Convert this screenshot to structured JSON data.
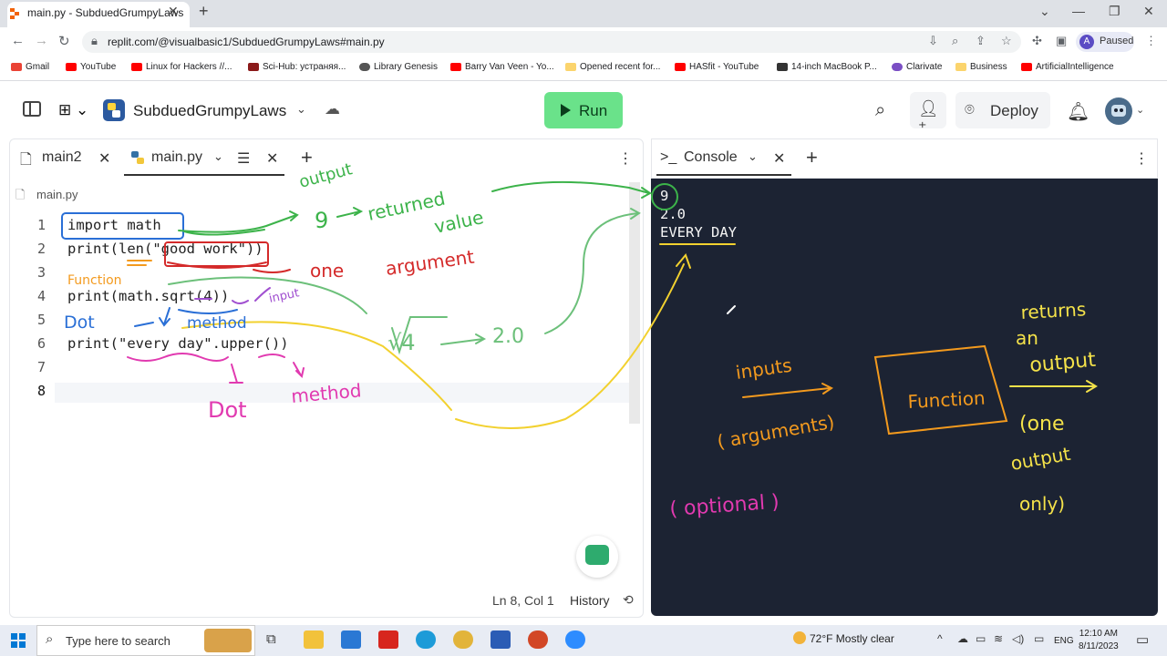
{
  "browser": {
    "tab_title": "main.py - SubduedGrumpyLaws",
    "url": "replit.com/@visualbasic1/SubduedGrumpyLaws#main.py",
    "profile_initial": "A",
    "profile_status": "Paused",
    "bookmarks": [
      "Gmail",
      "YouTube",
      "Linux for Hackers //...",
      "Sci-Hub: устраняя...",
      "Library Genesis",
      "Barry Van Veen - Yo...",
      "Opened recent for...",
      "HASfit - YouTube",
      "14-inch MacBook P...",
      "Clarivate",
      "Business",
      "ArtificialIntelligence"
    ]
  },
  "replit": {
    "repl_name": "SubduedGrumpyLaws",
    "run_label": "Run",
    "deploy_label": "Deploy",
    "editor_tabs": [
      "main2",
      "main.py"
    ],
    "breadcrumb": "main.py",
    "line_numbers": [
      "1",
      "2",
      "3",
      "4",
      "5",
      "6",
      "7",
      "8"
    ],
    "code_lines": [
      "import math",
      "print(len(\"good work\"))",
      "",
      "print(math.sqrt(4))",
      "",
      "print(\"every day\".upper())",
      "",
      ""
    ],
    "status_position": "Ln 8, Col 1",
    "history_label": "History",
    "console_tab": "Console",
    "console_output": [
      "9",
      "2.0",
      "EVERY DAY"
    ]
  },
  "annotations": {
    "output": "output",
    "nine": "9",
    "returned": "returned",
    "value": "value",
    "one": "one",
    "argument": "argument",
    "function_small": "Function",
    "input": "input",
    "dot1": "Dot",
    "method1": "method",
    "sqrt4": "√4",
    "two_point_oh": "2.0",
    "dot2": "Dot",
    "method2": "method",
    "inputs": "inputs",
    "arguments": "( arguments)",
    "optional": "( optional )",
    "function_box": "Function",
    "returns": "returns",
    "an": "an",
    "output_big": "output",
    "one_paren": "(one",
    "output_only": "output",
    "only": "only)"
  },
  "taskbar": {
    "search_placeholder": "Type here to search",
    "weather": "72°F  Mostly clear",
    "language": "ENG",
    "time": "12:10 AM",
    "date": "8/11/2023"
  }
}
